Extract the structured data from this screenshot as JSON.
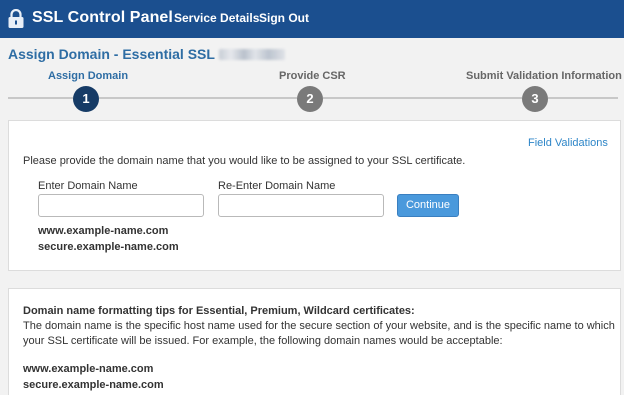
{
  "header": {
    "brand": "SSL Control Panel",
    "nav": [
      "Service Details",
      "Sign Out"
    ],
    "bg_color": "#1b4f8f"
  },
  "page": {
    "title": "Assign Domain - Essential SSL",
    "redacted_icon": "blurred-order-number"
  },
  "steps": [
    {
      "label": "Assign Domain",
      "number": "1",
      "active": true
    },
    {
      "label": "Provide CSR",
      "number": "2",
      "active": false
    },
    {
      "label": "Submit Validation Information",
      "number": "3",
      "active": false
    }
  ],
  "form": {
    "field_validations_link": "Field Validations",
    "instruction": "Please provide the domain name that you would like to be assigned to your SSL certificate.",
    "domain_label": "Enter Domain Name",
    "domain_value": "",
    "reenter_label": "Re-Enter Domain Name",
    "reenter_value": "",
    "continue_label": "Continue",
    "examples": [
      "www.example-name.com",
      "secure.example-name.com"
    ]
  },
  "tips": {
    "heading": "Domain name formatting tips for Essential, Premium, Wildcard certificates:",
    "line1": "The domain name is the specific host name used for the secure section of your website, and is the specific name to which",
    "line2": "your SSL certificate will be issued. For example, the following domain names would be acceptable:",
    "examples": [
      "www.example-name.com",
      "secure.example-name.com"
    ]
  }
}
